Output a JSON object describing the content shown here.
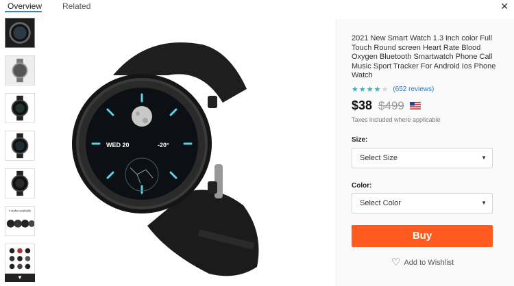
{
  "tabs": [
    {
      "label": "Overview",
      "active": true
    },
    {
      "label": "Related",
      "active": false
    }
  ],
  "close_label": "✕",
  "thumbnails": {
    "count": 7,
    "styles_caption": "4 styles available",
    "scroll_glyph": "▼"
  },
  "product": {
    "title": "2021 New Smart Watch 1.3 inch color Full Touch Round screen Heart Rate Blood Oxygen Bluetooth Smartwatch Phone Call Music Sport Tracker For Android Ios Phone Watch",
    "rating": 4,
    "rating_max": 5,
    "reviews": "(652 reviews)",
    "price": "$38",
    "old_price": "$499",
    "tax_note": "Taxes included where applicable",
    "flag": "us-flag-icon"
  },
  "watch_face": {
    "date": "WED 20",
    "temp": "-20°"
  },
  "size": {
    "label": "Size:",
    "placeholder": "Select Size"
  },
  "color": {
    "label": "Color:",
    "placeholder": "Select Color"
  },
  "buy_label": "Buy",
  "wishlist_label": "Add to Wishlist",
  "colors": {
    "accent": "#ff5a1f",
    "tab_underline": "#2f87d9",
    "star": "#2bb3c0",
    "link": "#2a7ab8"
  }
}
